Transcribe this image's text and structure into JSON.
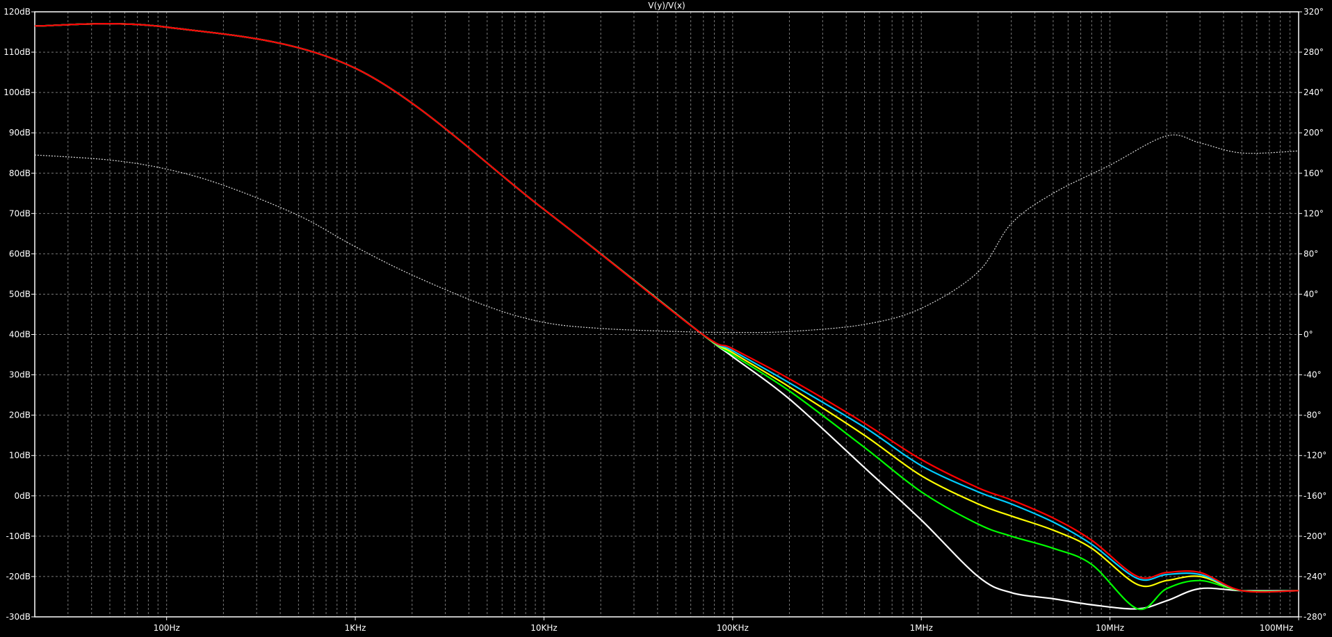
{
  "chart_data": {
    "type": "line",
    "title": "V(y)/V(x)",
    "x_scale": "log",
    "xlim": [
      20,
      100000000
    ],
    "x_tick_values": [
      100,
      1000,
      10000,
      100000,
      1000000,
      10000000,
      100000000
    ],
    "x_tick_labels": [
      "100Hz",
      "1KHz",
      "10KHz",
      "100KHz",
      "1MHz",
      "10MHz",
      "100MHz"
    ],
    "ylim": [
      -30,
      120
    ],
    "y_tick_values": [
      120,
      110,
      100,
      90,
      80,
      70,
      60,
      50,
      40,
      30,
      20,
      10,
      0,
      -10,
      -20,
      -30
    ],
    "y_tick_labels": [
      "120dB",
      "110dB",
      "100dB",
      "90dB",
      "80dB",
      "70dB",
      "60dB",
      "50dB",
      "40dB",
      "30dB",
      "20dB",
      "10dB",
      "0dB",
      "-10dB",
      "-20dB",
      "-30dB"
    ],
    "y2lim": [
      -280,
      320
    ],
    "y2_tick_values": [
      320,
      280,
      240,
      200,
      160,
      120,
      80,
      40,
      0,
      -40,
      -80,
      -120,
      -160,
      -200,
      -240,
      -280
    ],
    "y2_tick_labels": [
      "320°",
      "280°",
      "240°",
      "200°",
      "160°",
      "120°",
      "80°",
      "40°",
      "0°",
      "-40°",
      "-80°",
      "-120°",
      "-160°",
      "-200°",
      "-240°",
      "-280°"
    ],
    "grid": true,
    "background": "#000000",
    "grid_color": "#7a7a7a",
    "series": [
      {
        "axis": "y",
        "color": "#ffffff",
        "style": "solid",
        "x": [
          20,
          100,
          1000,
          10000,
          65000,
          100000,
          200000,
          500000,
          1000000,
          2000000,
          3000000,
          5000000,
          8000000,
          14000000,
          20000000,
          30000000,
          50000000,
          100000000
        ],
        "y": [
          116.5,
          116.2,
          106,
          71,
          41,
          34.5,
          24,
          7,
          -6,
          -20,
          -24,
          -25.5,
          -27,
          -28,
          -26,
          -23,
          -23.5,
          -23.5
        ]
      },
      {
        "axis": "y",
        "color": "#00ff00",
        "style": "solid",
        "x": [
          20,
          100,
          1000,
          10000,
          65000,
          100000,
          200000,
          500000,
          1000000,
          2000000,
          3000000,
          5000000,
          8000000,
          14000000,
          20000000,
          30000000,
          50000000,
          100000000
        ],
        "y": [
          116.5,
          116.2,
          106,
          71,
          41,
          35,
          26,
          12,
          1,
          -7,
          -10,
          -13,
          -17,
          -28,
          -23,
          -21,
          -23.5,
          -23.5
        ]
      },
      {
        "axis": "y",
        "color": "#ffff00",
        "style": "solid",
        "x": [
          20,
          100,
          1000,
          10000,
          65000,
          100000,
          200000,
          500000,
          1000000,
          2000000,
          3000000,
          5000000,
          8000000,
          14000000,
          20000000,
          30000000,
          50000000,
          100000000
        ],
        "y": [
          116.5,
          116.2,
          106,
          71,
          41,
          35.5,
          27,
          15,
          5,
          -2,
          -5,
          -8.5,
          -13,
          -22,
          -21,
          -20,
          -23.5,
          -23.5
        ]
      },
      {
        "axis": "y",
        "color": "#00ccff",
        "style": "solid",
        "x": [
          20,
          100,
          1000,
          10000,
          65000,
          100000,
          200000,
          500000,
          1000000,
          2000000,
          3000000,
          5000000,
          8000000,
          14000000,
          20000000,
          30000000,
          50000000,
          100000000
        ],
        "y": [
          116.5,
          116.2,
          106,
          71,
          41,
          36,
          28,
          17,
          7.5,
          1,
          -2,
          -6.5,
          -12,
          -20.5,
          -19.5,
          -19.5,
          -23.5,
          -23.5
        ]
      },
      {
        "axis": "y",
        "color": "#ff0000",
        "style": "solid",
        "x": [
          20,
          100,
          1000,
          10000,
          65000,
          100000,
          200000,
          500000,
          1000000,
          2000000,
          3000000,
          5000000,
          8000000,
          14000000,
          20000000,
          30000000,
          50000000,
          100000000
        ],
        "y": [
          116.5,
          116.2,
          106,
          71,
          41,
          36.5,
          29,
          18,
          9,
          2,
          -1,
          -5.5,
          -11,
          -20,
          -19,
          -19,
          -23.5,
          -23.5
        ]
      },
      {
        "axis": "y2",
        "color": "#dddddd",
        "style": "dashed",
        "x": [
          20,
          50,
          100,
          200,
          500,
          1000,
          2000,
          5000,
          10000,
          20000,
          50000,
          100000,
          200000,
          500000,
          1000000,
          2000000,
          3000000,
          5000000,
          10000000,
          20000000,
          30000000,
          50000000,
          100000000
        ],
        "y": [
          178,
          173,
          164,
          148,
          118,
          87,
          59,
          28,
          12,
          6,
          3,
          2,
          3,
          10,
          26,
          62,
          110,
          140,
          168,
          197,
          190,
          180,
          182
        ]
      }
    ]
  }
}
